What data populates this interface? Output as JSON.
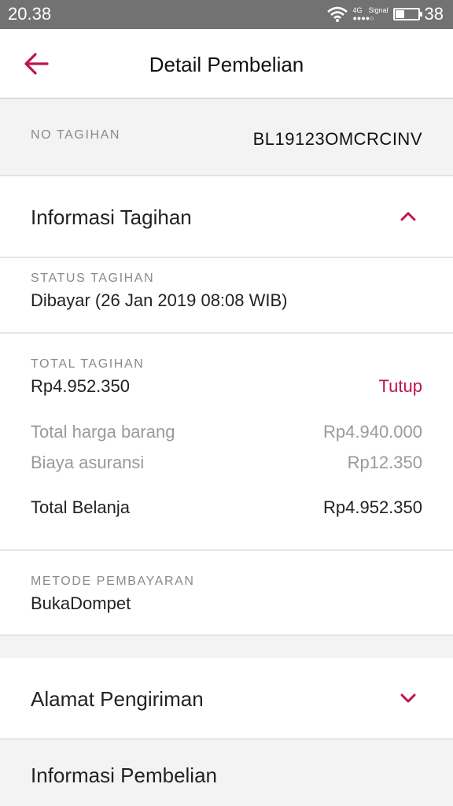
{
  "status_bar": {
    "time": "20.38",
    "network": "4G",
    "signal_label": "Signal",
    "signal_dots": "●●●●○",
    "battery": "38",
    "battery_level": 0.38
  },
  "app_bar": {
    "title": "Detail Pembelian",
    "back_icon": "arrow-left-icon"
  },
  "invoice": {
    "label": "NO TAGIHAN",
    "value": "BL19123OMCRCINV"
  },
  "sections": {
    "informasi_tagihan": "Informasi Tagihan",
    "alamat_pengiriman": "Alamat Pengiriman",
    "informasi_pembelian": "Informasi Pembelian"
  },
  "status_tagihan": {
    "label": "STATUS TAGIHAN",
    "value": "Dibayar (26 Jan 2019 08:08 WIB)"
  },
  "total_tagihan": {
    "label": "TOTAL TAGIHAN",
    "value": "Rp4.952.350",
    "toggle_label": "Tutup",
    "lines": [
      {
        "label": "Total harga barang",
        "value": "Rp4.940.000"
      },
      {
        "label": "Biaya asuransi",
        "value": "Rp12.350"
      }
    ],
    "total_label": "Total Belanja",
    "total_value": "Rp4.952.350"
  },
  "metode_pembayaran": {
    "label": "METODE PEMBAYARAN",
    "value": "BukaDompet"
  },
  "colors": {
    "accent": "#c0134f",
    "status_bar": "#727272",
    "gray_bg": "#f3f3f3"
  }
}
